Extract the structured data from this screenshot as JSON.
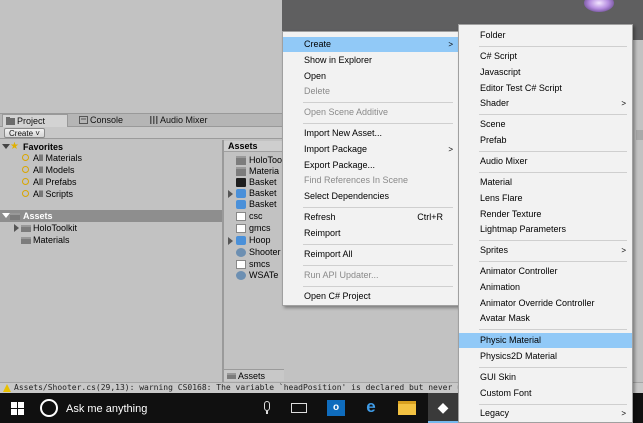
{
  "tabs": {
    "project": "Project",
    "console": "Console",
    "audio_mixer": "Audio Mixer"
  },
  "toolbar": {
    "create_label": "Create ˅"
  },
  "tree": {
    "favorites": "Favorites",
    "all_materials": "All Materials",
    "all_models": "All Models",
    "all_prefabs": "All Prefabs",
    "all_scripts": "All Scripts",
    "assets": "Assets",
    "holotoolkit": "HoloToolkit",
    "materials": "Materials"
  },
  "asset_list": {
    "header": "Assets",
    "items": [
      "HoloToo",
      "Materia",
      "Basket",
      "Basket",
      "Basket",
      "csc",
      "gmcs",
      "Hoop",
      "Shooter",
      "smcs",
      "WSATe"
    ],
    "footer": "Assets"
  },
  "status": {
    "message": "Assets/Shooter.cs(29,13): warning CS0168: The variable `headPosition' is declared but never used"
  },
  "taskbar": {
    "search_placeholder": "Ask me anything",
    "outlook_letter": "o",
    "edge_letter": "e",
    "unity_glyph": "◆"
  },
  "context_menu": {
    "create": "Create",
    "show_in_explorer": "Show in Explorer",
    "open": "Open",
    "delete": "Delete",
    "open_scene_additive": "Open Scene Additive",
    "import_new_asset": "Import New Asset...",
    "import_package": "Import Package",
    "export_package": "Export Package...",
    "find_references": "Find References In Scene",
    "select_dependencies": "Select Dependencies",
    "refresh": "Refresh",
    "refresh_shortcut": "Ctrl+R",
    "reimport": "Reimport",
    "reimport_all": "Reimport All",
    "run_api_updater": "Run API Updater...",
    "open_csharp_project": "Open C# Project"
  },
  "submenu": {
    "folder": "Folder",
    "csharp_script": "C# Script",
    "javascript": "Javascript",
    "editor_test": "Editor Test C# Script",
    "shader": "Shader",
    "scene": "Scene",
    "prefab": "Prefab",
    "audio_mixer": "Audio Mixer",
    "material": "Material",
    "lens_flare": "Lens Flare",
    "render_texture": "Render Texture",
    "lightmap_parameters": "Lightmap Parameters",
    "sprites": "Sprites",
    "animator_controller": "Animator Controller",
    "animation": "Animation",
    "animator_override": "Animator Override Controller",
    "avatar_mask": "Avatar Mask",
    "physic_material": "Physic Material",
    "physics2d_material": "Physics2D Material",
    "gui_skin": "GUI Skin",
    "custom_font": "Custom Font",
    "legacy": "Legacy"
  },
  "colors": {
    "highlight": "#91c9f7",
    "selected_tree": "#8e8e8e",
    "taskbar": "#101010",
    "warning": "#e8c000"
  }
}
